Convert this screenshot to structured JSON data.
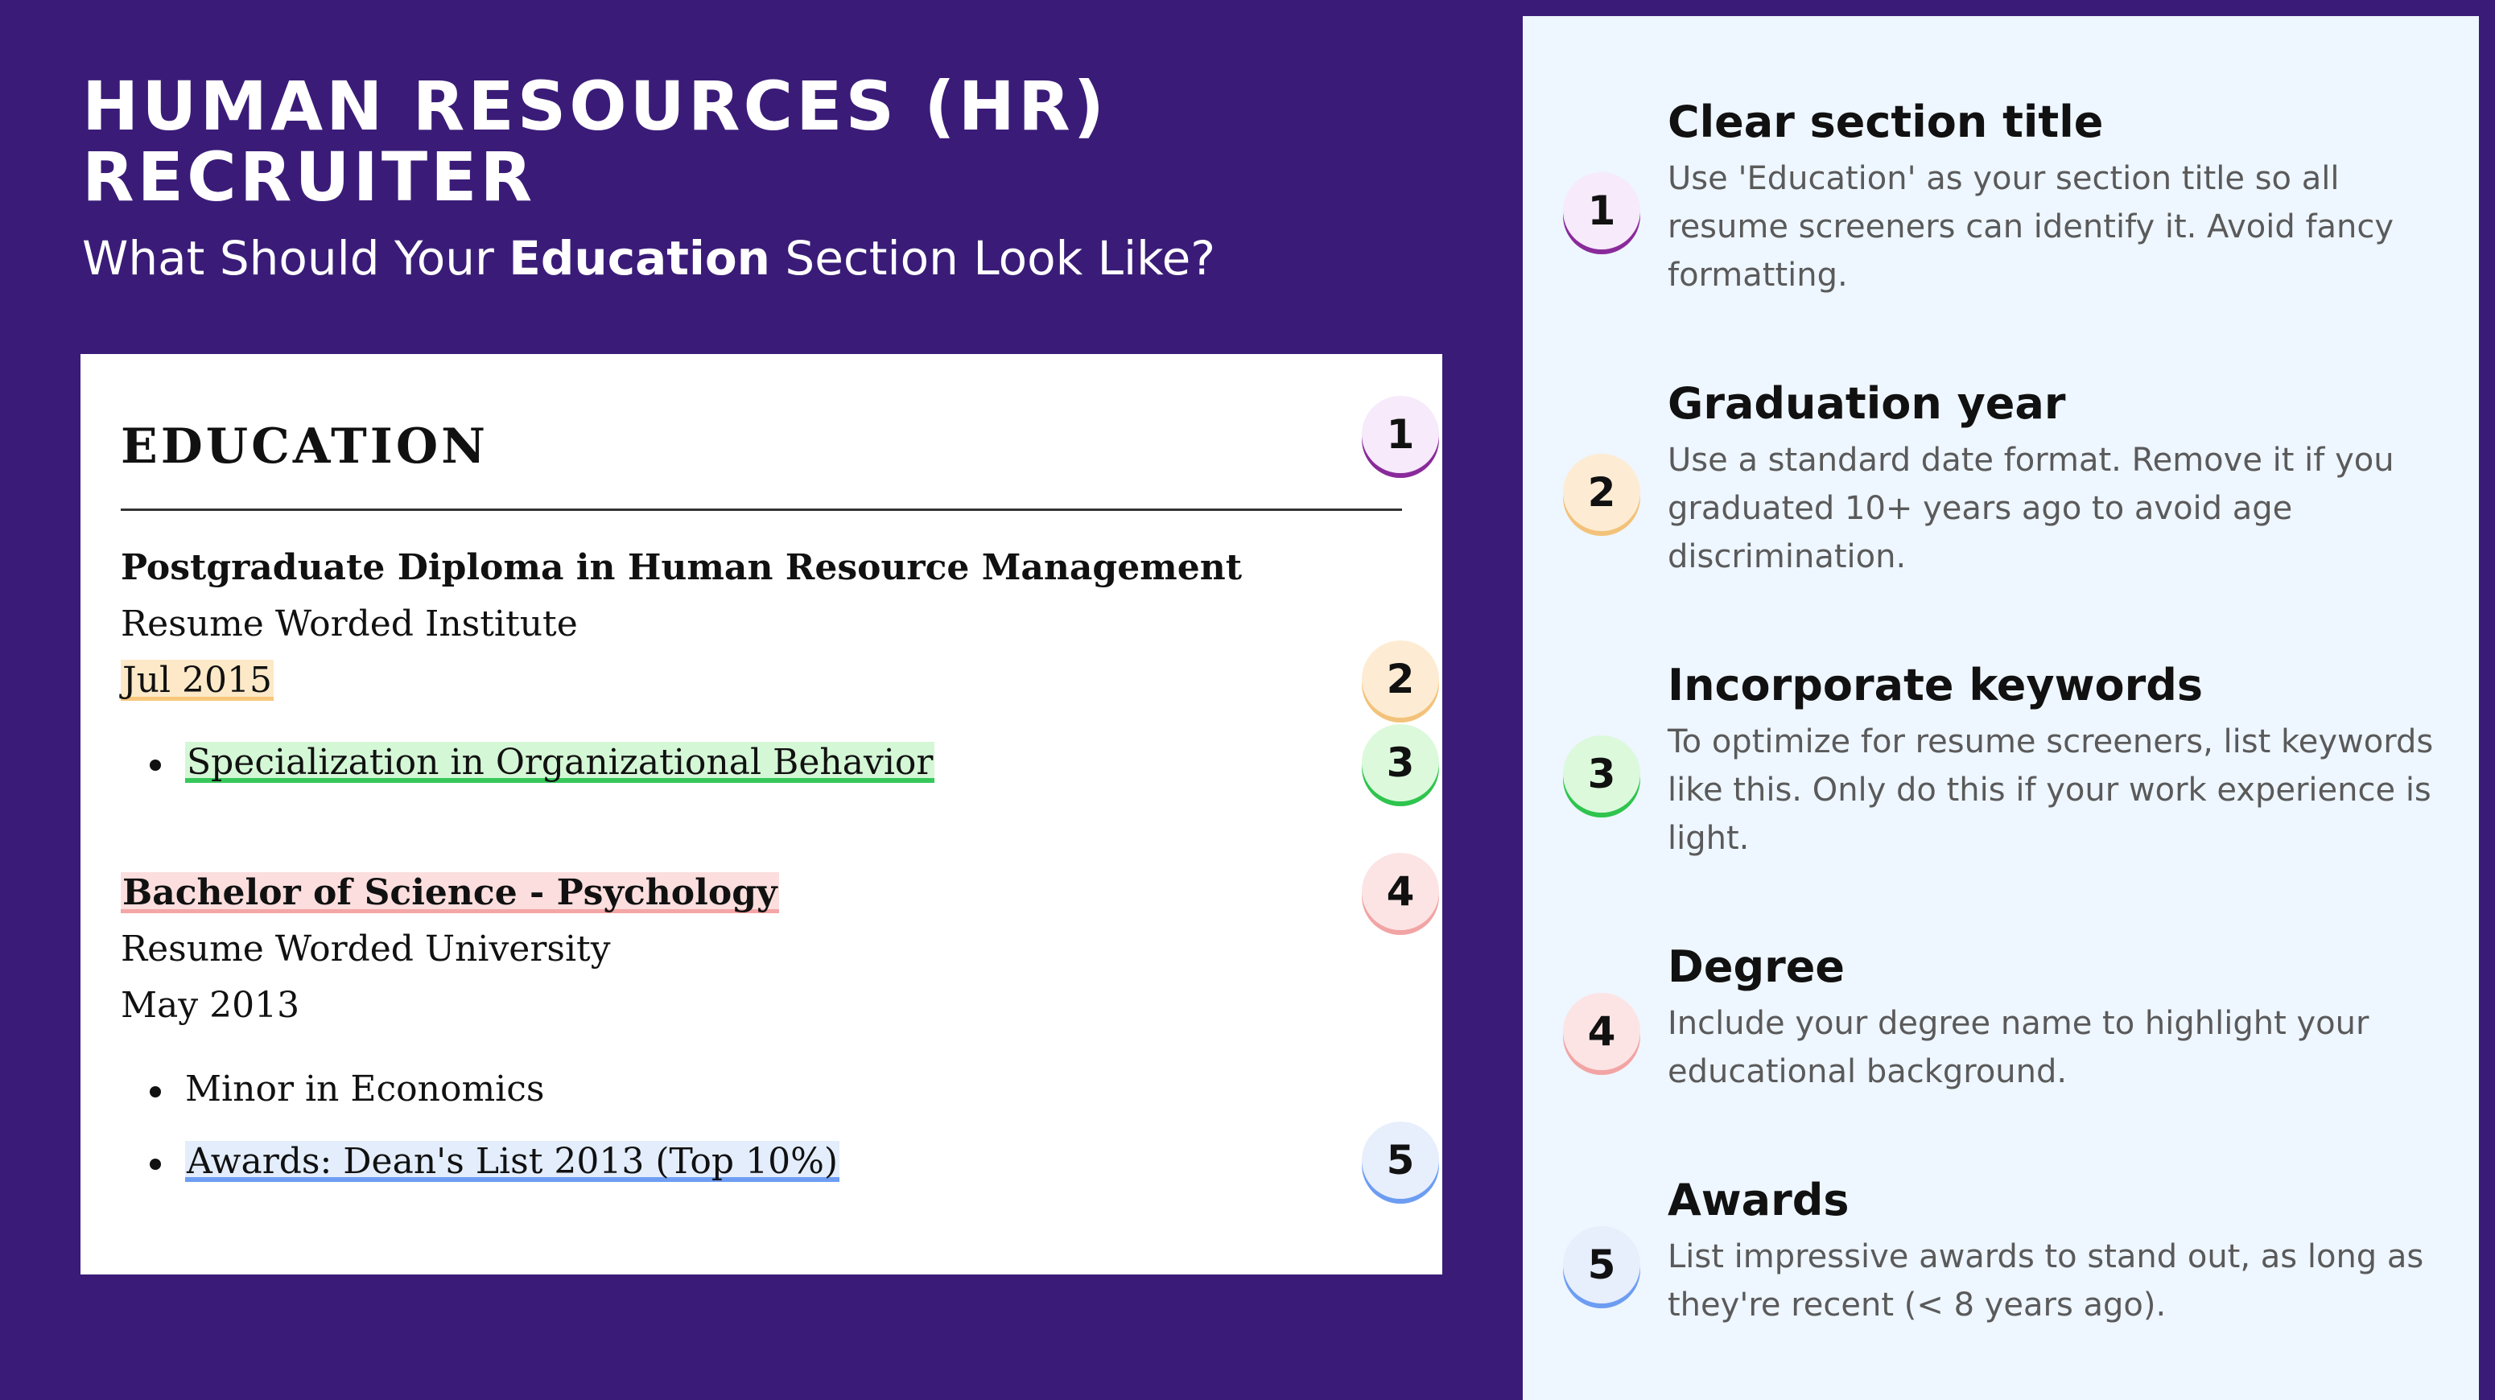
{
  "header": {
    "title_line1": "HUMAN RESOURCES (HR)",
    "title_line2": "RECRUITER",
    "subtitle_pre": "What Should Your ",
    "subtitle_bold": "Education",
    "subtitle_post": " Section Look Like?"
  },
  "resume": {
    "section_heading": "EDUCATION",
    "entries": [
      {
        "degree": "Postgraduate Diploma in Human Resource Management",
        "institution": "Resume Worded Institute",
        "date": "Jul 2015",
        "bullets": [
          "Specialization in Organizational Behavior"
        ]
      },
      {
        "degree": "Bachelor of Science - Psychology",
        "institution": "Resume Worded University",
        "date": "May 2013",
        "bullets": [
          "Minor in Economics",
          "Awards: Dean's List 2013 (Top 10%)"
        ]
      }
    ],
    "markers": [
      "1",
      "2",
      "3",
      "4",
      "5"
    ]
  },
  "tips": [
    {
      "number": "1",
      "title": "Clear section title",
      "description": "Use 'Education' as your section title so all resume screeners can identify it. Avoid fancy formatting."
    },
    {
      "number": "2",
      "title": "Graduation year",
      "description": "Use a standard date format. Remove it if you graduated 10+ years ago to avoid age discrimination."
    },
    {
      "number": "3",
      "title": "Incorporate keywords",
      "description": "To optimize for resume screeners, list keywords like this. Only do this if your work experience is light."
    },
    {
      "number": "4",
      "title": "Degree",
      "description": "Include your degree name to highlight your educational background."
    },
    {
      "number": "5",
      "title": "Awards",
      "description": "List impressive awards to stand out, as long as they're recent (< 8 years ago)."
    }
  ],
  "colors": {
    "background": "#3a1c78",
    "panel": "#eef6ff",
    "marker_1": "#8a2a9a",
    "marker_2": "#f3c27a",
    "marker_3": "#2ec44d",
    "marker_4": "#f2a4a4",
    "marker_5": "#6d9df2"
  }
}
